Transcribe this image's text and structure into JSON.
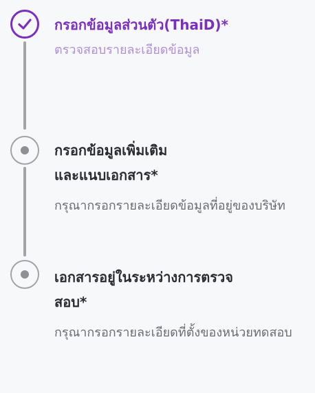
{
  "steps": [
    {
      "title": "กรอกข้อมูลส่วนตัว(ThaiD)*",
      "description": "ตรวจสอบรายละเอียดข้อมูล",
      "status": "completed",
      "icon": "check-circle-icon"
    },
    {
      "title": "กรอกข้อมูลเพิ่มเติม\nและแนบเอกสาร*",
      "description": "กรุณากรอกรายละเอียดข้อมูลที่อยู่ของบริษัท",
      "status": "pending",
      "icon": "dot-circle-icon"
    },
    {
      "title": "เอกสารอยู่ในระหว่างการตรวจสอบ*",
      "description": "กรุณากรอกรายละเอียดที่ตั้งของหน่วยทดสอบ",
      "status": "pending",
      "icon": "dot-circle-icon"
    }
  ],
  "colors": {
    "active": "#7b2fbf",
    "active_description": "#b08fd6",
    "pending_ring": "#a3a3a8",
    "title_text": "#2b2b30",
    "description_text": "#6b6b70",
    "background": "#f7f8fa"
  }
}
